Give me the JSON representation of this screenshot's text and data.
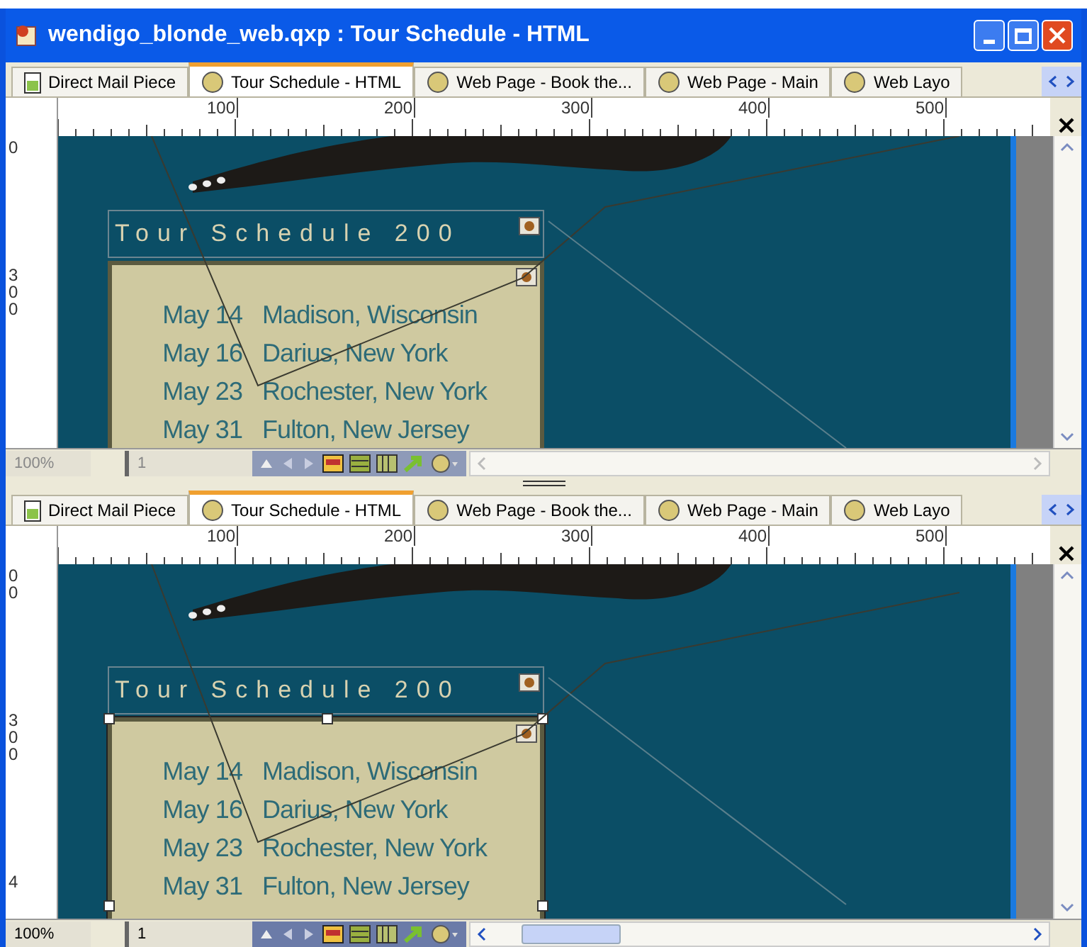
{
  "window": {
    "title": "wendigo_blonde_web.qxp : Tour Schedule - HTML"
  },
  "panes": [
    {
      "active": false,
      "tabs": [
        {
          "label": "Direct Mail Piece",
          "kind": "print",
          "selected": false
        },
        {
          "label": "Tour Schedule - HTML",
          "kind": "web",
          "selected": true
        },
        {
          "label": "Web Page - Book the...",
          "kind": "web",
          "selected": false
        },
        {
          "label": "Web Page - Main",
          "kind": "web",
          "selected": false
        },
        {
          "label": "Web Layo",
          "kind": "web",
          "selected": false
        }
      ],
      "ruler": [
        "100",
        "200",
        "300",
        "400",
        "500"
      ],
      "vertical_ruler": [
        [
          "0"
        ],
        [
          "3",
          "0",
          "0"
        ]
      ],
      "frame": {
        "selected": false,
        "heading": "Tour Schedule 200",
        "rows": [
          {
            "date": "May 14",
            "place": "Madison, Wisconsin"
          },
          {
            "date": "May 16",
            "place": "Darius, New York"
          },
          {
            "date": "May 23",
            "place": "Rochester, New York"
          },
          {
            "date": "May 31",
            "place": "Fulton, New Jersey"
          }
        ]
      },
      "status": {
        "zoom": "100%",
        "page": "1"
      }
    },
    {
      "active": true,
      "tabs": [
        {
          "label": "Direct Mail Piece",
          "kind": "print",
          "selected": false
        },
        {
          "label": "Tour Schedule - HTML",
          "kind": "web",
          "selected": true
        },
        {
          "label": "Web Page - Book the...",
          "kind": "web",
          "selected": false
        },
        {
          "label": "Web Page - Main",
          "kind": "web",
          "selected": false
        },
        {
          "label": "Web Layo",
          "kind": "web",
          "selected": false
        }
      ],
      "ruler": [
        "100",
        "200",
        "300",
        "400",
        "500"
      ],
      "vertical_ruler": [
        [
          "0",
          "0"
        ],
        [
          "3",
          "0",
          "0"
        ],
        [
          "4"
        ]
      ],
      "frame": {
        "selected": true,
        "heading": "Tour Schedule 200",
        "rows": [
          {
            "date": "May 14",
            "place": "Madison, Wisconsin"
          },
          {
            "date": "May 16",
            "place": "Darius, New York"
          },
          {
            "date": "May 23",
            "place": "Rochester, New York"
          },
          {
            "date": "May 31",
            "place": "Fulton, New Jersey"
          }
        ]
      },
      "status": {
        "zoom": "100%",
        "page": "1"
      }
    }
  ]
}
